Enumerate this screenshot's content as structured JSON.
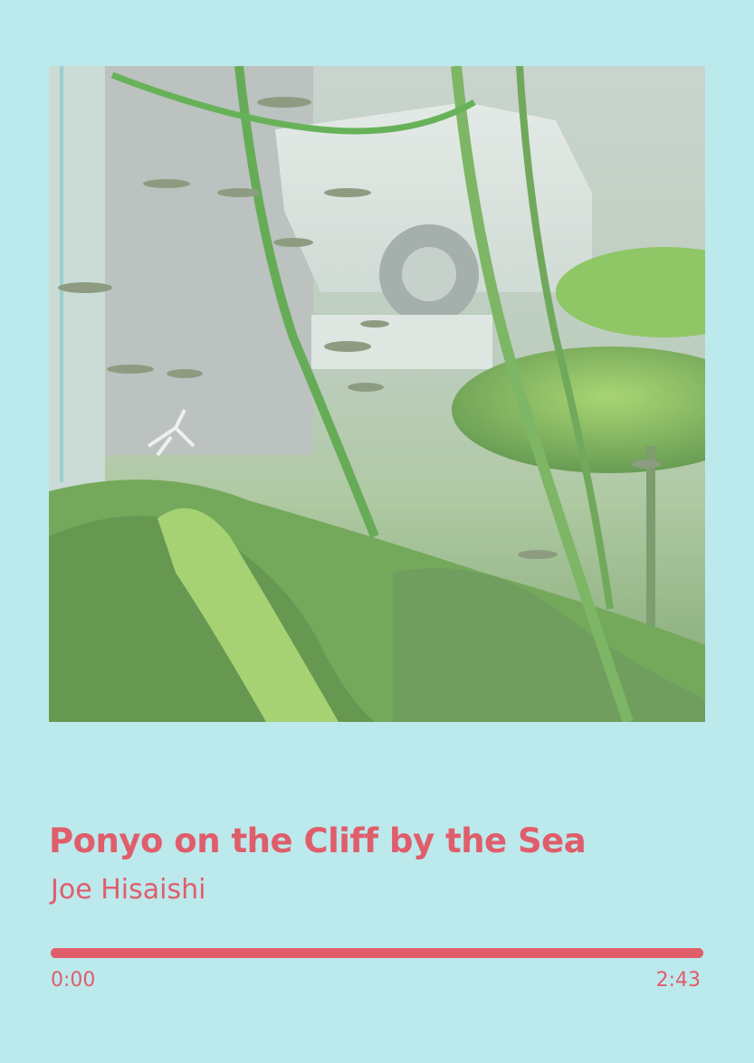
{
  "track": {
    "title": "Ponyo on the Cliff by the Sea",
    "artist": "Joe Hisaishi"
  },
  "cover": {
    "description_icon": "aquarium-cover-art"
  },
  "player": {
    "current_time": "0:00",
    "total_time": "2:43",
    "progress_fraction": 1.0
  },
  "colors": {
    "background": "#bce9ec",
    "accent": "#e05d6b"
  }
}
